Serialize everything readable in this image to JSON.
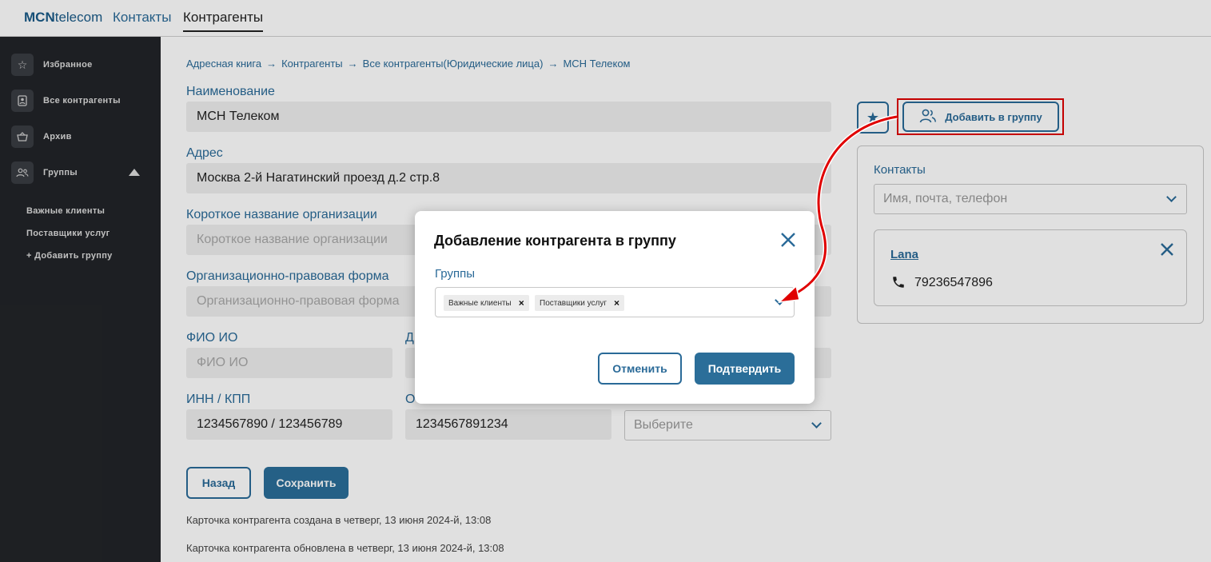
{
  "topbar": {
    "logo_bold": "MCN",
    "logo_rest": "telecom",
    "nav_contacts": "Контакты",
    "nav_counterparties": "Контрагенты"
  },
  "sidebar": {
    "favorites": "Избранное",
    "all_counterparties": "Все контрагенты",
    "archive": "Архив",
    "groups": "Группы",
    "sub_important": "Важные клиенты",
    "sub_providers": "Поставщики услуг",
    "sub_add": "+ Добавить группу"
  },
  "breadcrumb": [
    "Адресная книга",
    "Контрагенты",
    "Все контрагенты(Юридические лица)",
    "МСН Телеком"
  ],
  "breadcrumb_sep": "→",
  "form": {
    "name_label": "Наименование",
    "name_value": "МСН Телеком",
    "address_label": "Адрес",
    "address_value": "Москва 2-й Нагатинский проезд д.2 стр.8",
    "short_name_label": "Короткое название организации",
    "short_name_placeholder": "Короткое название организации",
    "legal_form_label": "Организационно-правовая форма",
    "legal_form_placeholder": "Организационно-правовая форма",
    "fio_label": "ФИО ИО",
    "fio_placeholder": "ФИО ИО",
    "col2_label_fragment": "Д",
    "inn_label": "ИНН / КПП",
    "inn_value": "1234567890 / 123456789",
    "col2_row2_label_fragment": "О",
    "col2_row2_value": "1234567891234",
    "select_placeholder": "Выберите",
    "back_button": "Назад",
    "save_button": "Сохранить",
    "created_note": "Карточка контрагента создана в четверг, 13 июня 2024-й, 13:08",
    "updated_note": "Карточка контрагента обновлена в четверг, 13 июня 2024-й, 13:08"
  },
  "right_panel": {
    "add_to_group_button": "Добавить в группу",
    "contacts_label": "Контакты",
    "contacts_placeholder": "Имя, почта, телефон",
    "contact_name": "Lana",
    "contact_phone": "79236547896"
  },
  "modal": {
    "title": "Добавление контрагента в группу",
    "groups_label": "Группы",
    "chips": [
      "Важные клиенты",
      "Поставщики услуг"
    ],
    "chip_remove": "×",
    "cancel_button": "Отменить",
    "confirm_button": "Подтвердить"
  },
  "colors": {
    "accent": "#2a6a98",
    "primary_fill": "#2b6e99",
    "sidebar_bg": "#222428",
    "highlight": "#e00000"
  }
}
